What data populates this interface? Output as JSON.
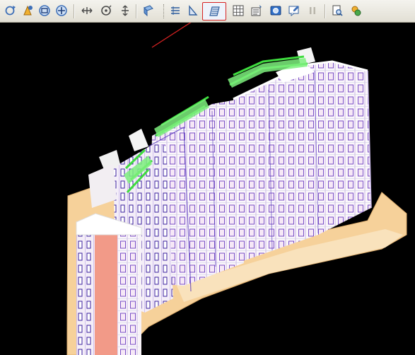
{
  "toolbar": {
    "buttons": [
      {
        "icon": "rotate-view-icon"
      },
      {
        "icon": "pan-view-icon"
      },
      {
        "icon": "zoom-window-icon"
      },
      {
        "icon": "zoom-realtime-icon"
      },
      {
        "icon": "move-horizontal-icon"
      },
      {
        "icon": "orbit-icon"
      },
      {
        "icon": "move-vertical-icon"
      },
      {
        "icon": "view-cube-icon"
      },
      {
        "icon": "floor-plan-layer-icon"
      },
      {
        "icon": "section-slice-icon"
      },
      {
        "icon": "floor-stack-display-icon"
      },
      {
        "icon": "grid-display-icon"
      },
      {
        "icon": "component-properties-icon"
      },
      {
        "icon": "render-camera-icon"
      },
      {
        "icon": "annotation-icon"
      },
      {
        "icon": "pause-icon"
      },
      {
        "icon": "print-preview-icon"
      },
      {
        "icon": "settings-icon"
      }
    ],
    "active_button": "floor-stack-display-icon"
  },
  "colors": {
    "toolbar_bg": "#e8e6dd",
    "viewport_bg": "#000000",
    "highlight_frame": "#d62222",
    "annotation_arrow": "#d62222",
    "facade_lines": "#7a3cc8",
    "balcony_green": "#45e245",
    "podium": "#f7d29a"
  }
}
